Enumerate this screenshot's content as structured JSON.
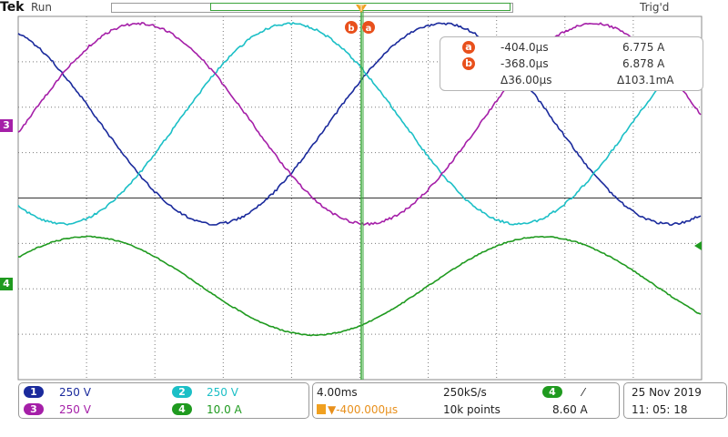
{
  "header": {
    "brand": "Tek",
    "run_state": "Run",
    "trigger_state": "Trig'd",
    "trigger_marker": "T"
  },
  "cursor_labels": {
    "a": "a",
    "b": "b"
  },
  "cursor_readout": {
    "a": {
      "label": "a",
      "time": "-404.0µs",
      "value": "6.775 A"
    },
    "b": {
      "label": "b",
      "time": "-368.0µs",
      "value": "6.878 A"
    },
    "delta": {
      "time": "Δ36.00µs",
      "value": "Δ103.1mA"
    }
  },
  "channel_markers": {
    "ch3": "3",
    "ch4": "4"
  },
  "channels": [
    {
      "num": "1",
      "scale": "250 V",
      "color": "#1a2a9c"
    },
    {
      "num": "2",
      "scale": "250 V",
      "color": "#1bbfc6"
    },
    {
      "num": "3",
      "scale": "250 V",
      "color": "#a51fa8"
    },
    {
      "num": "4",
      "scale": "10.0 A",
      "color": "#1f9a1f"
    }
  ],
  "timebase": {
    "scale": "4.00ms",
    "sample_rate": "250kS/s",
    "trigger_position": "▼-400.000µs",
    "record_length": "10k points"
  },
  "trigger": {
    "source": "4",
    "slope": "⁄",
    "level": "8.60 A",
    "source_color": "#1f9a1f"
  },
  "datetime": {
    "date": "25 Nov   2019",
    "time": "11: 05: 18"
  },
  "colors": {
    "ch1": "#1a2a9c",
    "ch2": "#1bbfc6",
    "ch3": "#a51fa8",
    "ch4": "#1f9a1f",
    "cursor": "#3aa83a",
    "accent": "#e8501c",
    "grid": "#7a7a7a"
  }
}
